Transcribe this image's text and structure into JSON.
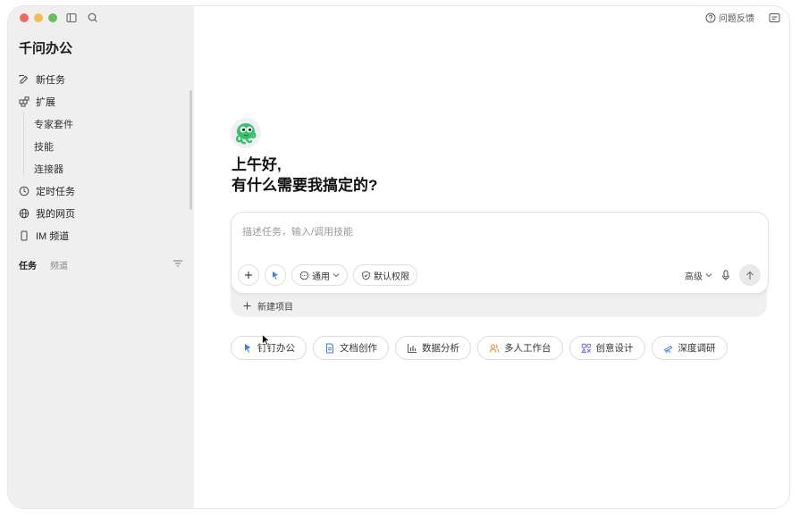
{
  "sidebar": {
    "app_title": "千问办公",
    "nav": [
      {
        "label": "新任务",
        "icon": "edit-icon"
      },
      {
        "label": "扩展",
        "icon": "extensions-icon"
      },
      {
        "label": "专家套件"
      },
      {
        "label": "技能"
      },
      {
        "label": "连接器"
      },
      {
        "label": "定时任务",
        "icon": "clock-icon"
      },
      {
        "label": "我的网页",
        "icon": "globe-icon"
      },
      {
        "label": "IM 频道",
        "icon": "phone-icon"
      }
    ],
    "tabs": {
      "tasks": "任务",
      "channels": "频道"
    }
  },
  "topbar": {
    "feedback": "问题反馈"
  },
  "main": {
    "greeting_line1": "上午好,",
    "greeting_line2": "有什么需要我搞定的?",
    "composer": {
      "placeholder": "描述任务，输入/调用技能",
      "mode": "通用",
      "permission": "默认权限",
      "level": "高级"
    },
    "new_project": "新建项目",
    "chips": [
      {
        "label": "钉钉办公",
        "icon": "dingtalk-icon",
        "color": "#3d7cf5"
      },
      {
        "label": "文档创作",
        "icon": "document-icon",
        "color": "#3d7cf5"
      },
      {
        "label": "数据分析",
        "icon": "bar-chart-icon",
        "color": "#555555"
      },
      {
        "label": "多人工作台",
        "icon": "people-icon",
        "color": "#e8833a"
      },
      {
        "label": "创意设计",
        "icon": "design-icon",
        "color": "#7b5cd6"
      },
      {
        "label": "深度调研",
        "icon": "telescope-icon",
        "color": "#3d7cf5"
      }
    ]
  },
  "colors": {
    "sidebar_bg": "#efefef",
    "accent": "#3d7cf5",
    "mascot_green": "#35c26b"
  }
}
